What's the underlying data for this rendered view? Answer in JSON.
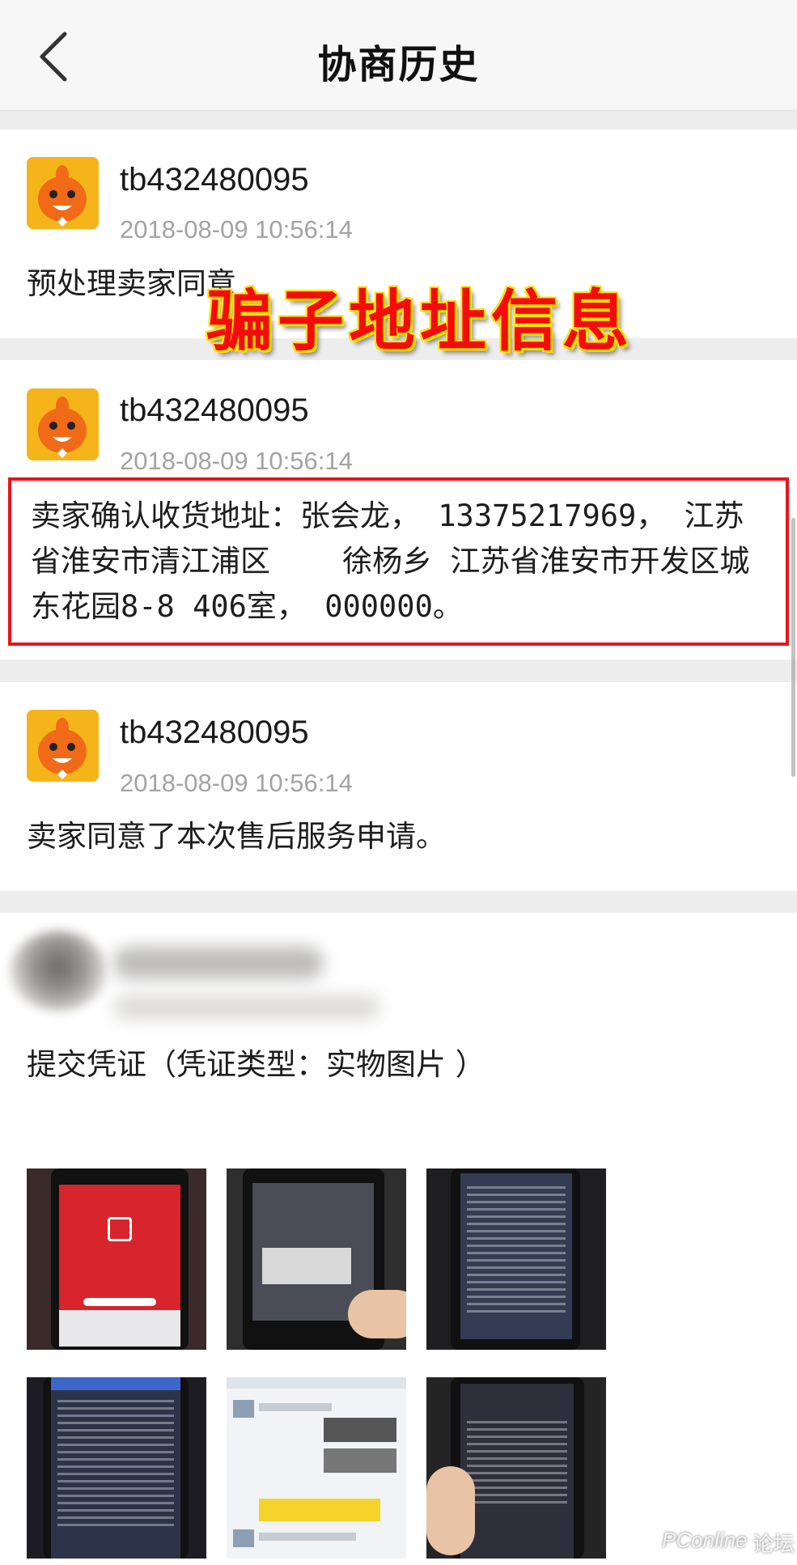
{
  "navbar": {
    "title": "协商历史"
  },
  "overlay": {
    "text": "骗子地址信息",
    "color": "#f40c0c"
  },
  "records": [
    {
      "username": "tb432480095",
      "time": "2018-08-09 10:56:14",
      "message": "预处理卖家同意"
    },
    {
      "username": "tb432480095",
      "time": "2018-08-09 10:56:14",
      "address_lines": [
        "卖家确认收货地址：张会龙， 13375217969， 江苏",
        "省淮安市清江浦区    徐杨乡 江苏省淮安市开发区城",
        "东花园8-8 406室， 000000。"
      ]
    },
    {
      "username": "tb432480095",
      "time": "2018-08-09 10:56:14",
      "message": "卖家同意了本次售后服务申请。"
    }
  ],
  "evidence": {
    "message": "提交凭证（凭证类型：实物图片 ）"
  },
  "watermark": {
    "brand": "PConline",
    "label": "论坛"
  },
  "colors": {
    "highlight_border": "#e8141a",
    "avatar_bg": "#f6b41b",
    "timestamp": "#a3a3a3"
  }
}
